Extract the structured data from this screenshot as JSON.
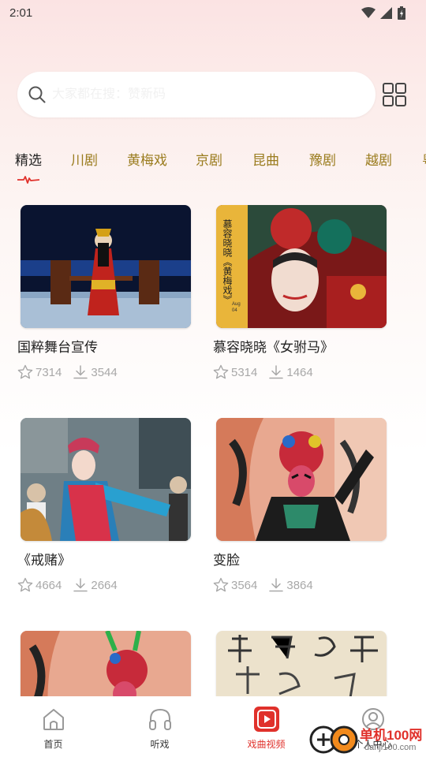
{
  "status_bar": {
    "time": "2:01"
  },
  "search": {
    "placeholder": "大家都在搜：赞新码"
  },
  "tabs": [
    "精选",
    "川剧",
    "黄梅戏",
    "京剧",
    "昆曲",
    "豫剧",
    "越剧",
    "粤"
  ],
  "active_tab": 0,
  "videos": [
    {
      "title": "国粹舞台宣传",
      "likes": "7314",
      "downloads": "3544"
    },
    {
      "title": "慕容晓晓《女驸马》",
      "likes": "5314",
      "downloads": "1464"
    },
    {
      "title": "《戒赌》",
      "likes": "4664",
      "downloads": "2664"
    },
    {
      "title": "变脸",
      "likes": "3564",
      "downloads": "3864"
    },
    {
      "title": "",
      "likes": "",
      "downloads": ""
    },
    {
      "title": "",
      "likes": "",
      "downloads": ""
    }
  ],
  "thumbnail_overlay": {
    "vertical_text": "慕容晓晓《黄梅戏》",
    "small_text": "Aug 04"
  },
  "bottom_nav": [
    {
      "label": "首页",
      "icon": "home-icon"
    },
    {
      "label": "听戏",
      "icon": "headphones-icon"
    },
    {
      "label": "戏曲视频",
      "icon": "video-play-icon"
    },
    {
      "label": "个人中心",
      "icon": "user-icon"
    }
  ],
  "active_nav": 2,
  "watermark": {
    "title": "单机100网",
    "url": "danji100.com"
  },
  "colors": {
    "accent": "#e0312b",
    "tab_text": "#9a7c1e",
    "stat_text": "#a8a8a8"
  }
}
